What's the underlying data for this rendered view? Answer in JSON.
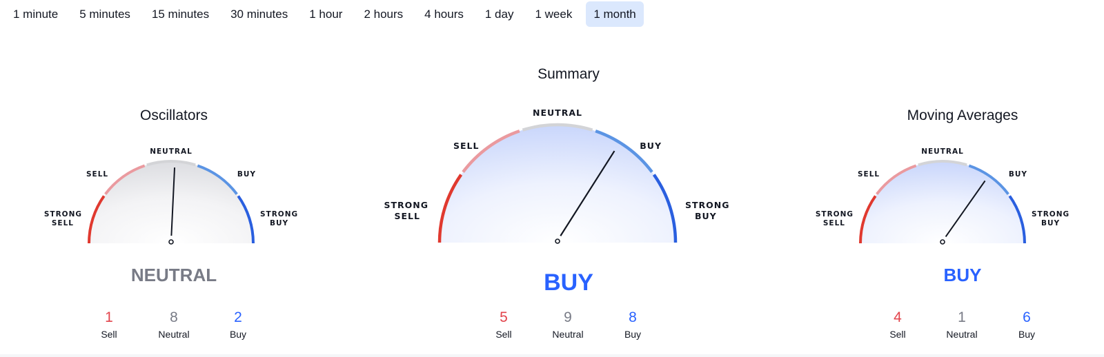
{
  "intervals": [
    {
      "label": "1 minute",
      "active": false
    },
    {
      "label": "5 minutes",
      "active": false
    },
    {
      "label": "15 minutes",
      "active": false
    },
    {
      "label": "30 minutes",
      "active": false
    },
    {
      "label": "1 hour",
      "active": false
    },
    {
      "label": "2 hours",
      "active": false
    },
    {
      "label": "4 hours",
      "active": false
    },
    {
      "label": "1 day",
      "active": false
    },
    {
      "label": "1 week",
      "active": false
    },
    {
      "label": "1 month",
      "active": true
    }
  ],
  "gauge_labels": {
    "strong_sell": [
      "STRONG",
      "SELL"
    ],
    "sell": "SELL",
    "neutral": "NEUTRAL",
    "buy": "BUY",
    "strong_buy": [
      "STRONG",
      "BUY"
    ]
  },
  "colors": {
    "strong_sell": "#e0392f",
    "sell": "#ea9a9f",
    "neutral": "#d3d4d7",
    "buy": "#5b94e4",
    "strong_buy": "#2a5fdf",
    "verdict_neutral": "#787b86",
    "verdict_buy": "#2962ff",
    "count_sell": "#e2434b",
    "count_neutral": "#787b86",
    "count_buy": "#2962ff"
  },
  "gauges": {
    "oscillators": {
      "title": "Oscillators",
      "verdict": "NEUTRAL",
      "needle_value": 0.03,
      "counts": {
        "sell": "1",
        "neutral": "8",
        "buy": "2"
      },
      "count_labels": {
        "sell": "Sell",
        "neutral": "Neutral",
        "buy": "Buy"
      }
    },
    "summary": {
      "title": "Summary",
      "verdict": "BUY",
      "needle_value": 0.36,
      "counts": {
        "sell": "5",
        "neutral": "9",
        "buy": "8"
      },
      "count_labels": {
        "sell": "Sell",
        "neutral": "Neutral",
        "buy": "Buy"
      }
    },
    "moving_averages": {
      "title": "Moving Averages",
      "verdict": "BUY",
      "needle_value": 0.39,
      "counts": {
        "sell": "4",
        "neutral": "1",
        "buy": "6"
      },
      "count_labels": {
        "sell": "Sell",
        "neutral": "Neutral",
        "buy": "Buy"
      }
    }
  }
}
